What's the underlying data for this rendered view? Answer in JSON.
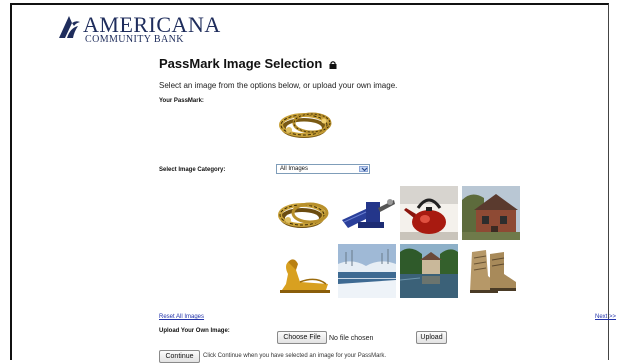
{
  "brand": {
    "name": "AMERICANA",
    "subtitle": "COMMUNITY BANK",
    "color": "#1f2d5c"
  },
  "page": {
    "title": "PassMark Image Selection",
    "instructions": "Select an image from the options below, or upload your own image."
  },
  "passmark": {
    "label": "Your PassMark:",
    "image": "gold-bracelet"
  },
  "category": {
    "label": "Select Image Category:",
    "selected": "All Images"
  },
  "images": [
    {
      "name": "gold-bracelet"
    },
    {
      "name": "bench-vise"
    },
    {
      "name": "red-kettle"
    },
    {
      "name": "brick-house"
    },
    {
      "name": "sphinx-statue"
    },
    {
      "name": "snowy-river"
    },
    {
      "name": "pond-village"
    },
    {
      "name": "boots"
    }
  ],
  "links": {
    "reset": "Reset All Images",
    "next": "Next >>"
  },
  "upload": {
    "label": "Upload Your Own Image:",
    "choose_file": "Choose File",
    "no_file": "No file chosen",
    "upload_button": "Upload"
  },
  "footer": {
    "continue_button": "Continue",
    "hint": "Click Continue when you have selected an image for your PassMark."
  }
}
